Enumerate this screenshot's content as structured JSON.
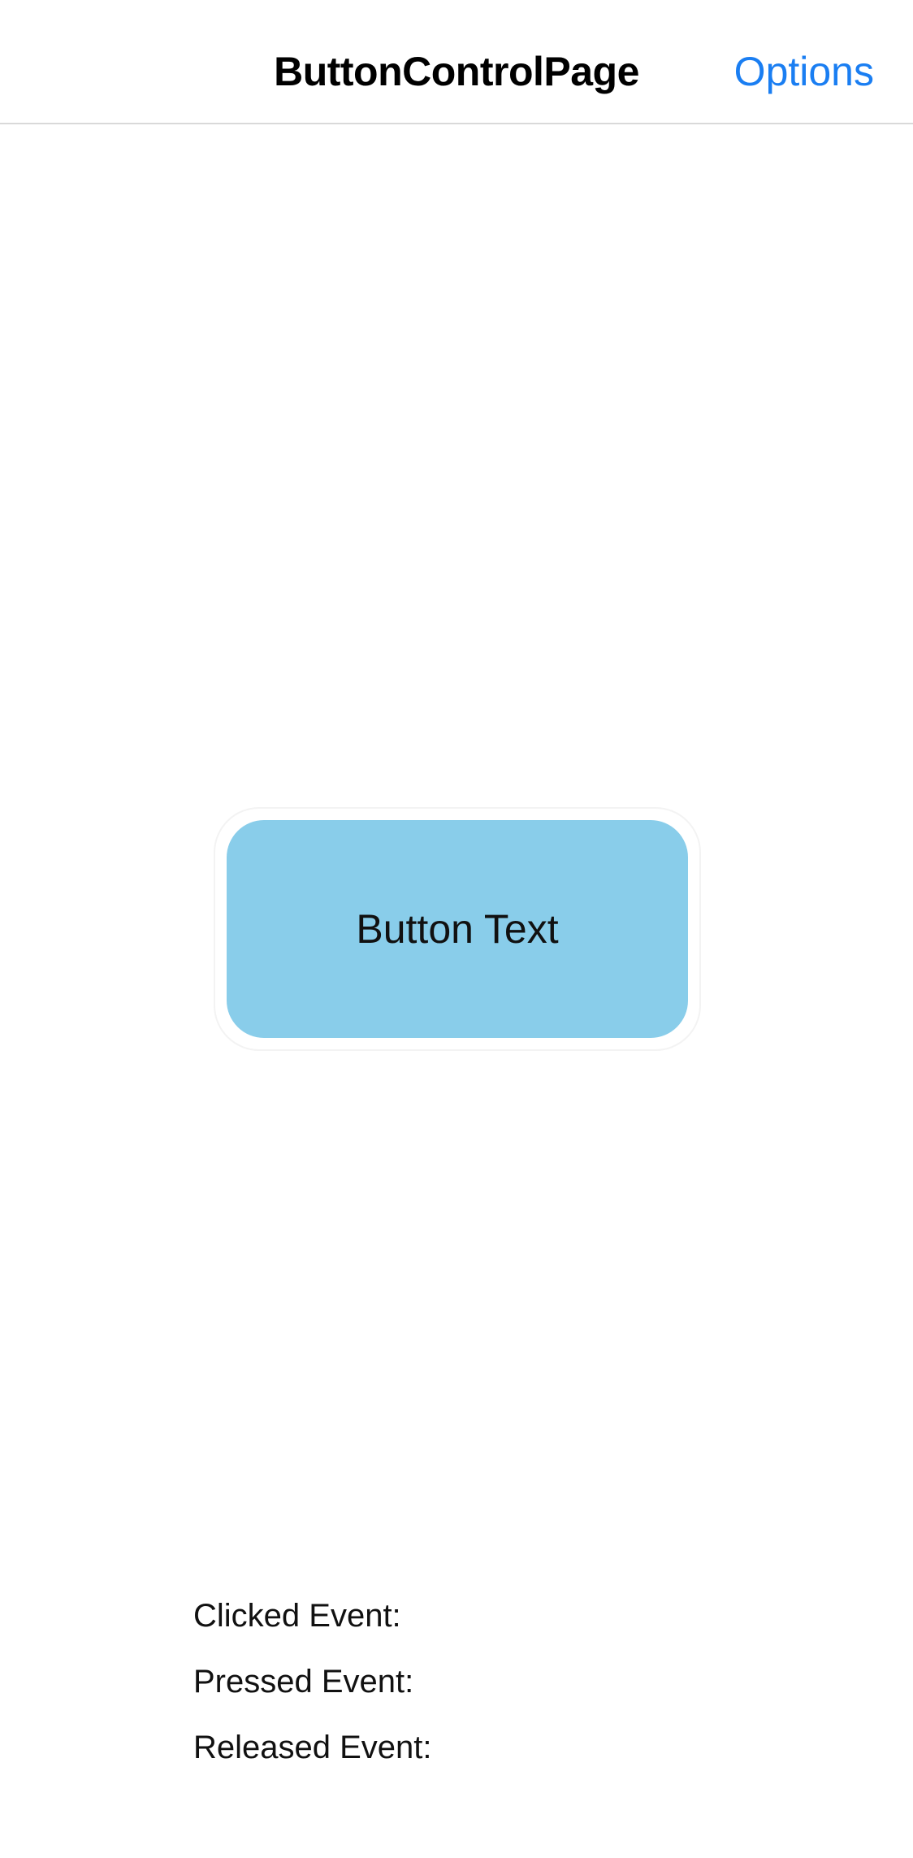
{
  "nav": {
    "title": "ButtonControlPage",
    "action_label": "Options"
  },
  "main_button": {
    "label": "Button Text",
    "background": "#89cdea"
  },
  "events": [
    {
      "label": "Clicked Event:",
      "value": ""
    },
    {
      "label": "Pressed Event:",
      "value": ""
    },
    {
      "label": "Released Event:",
      "value": ""
    }
  ],
  "colors": {
    "accent": "#1a7ef2"
  }
}
